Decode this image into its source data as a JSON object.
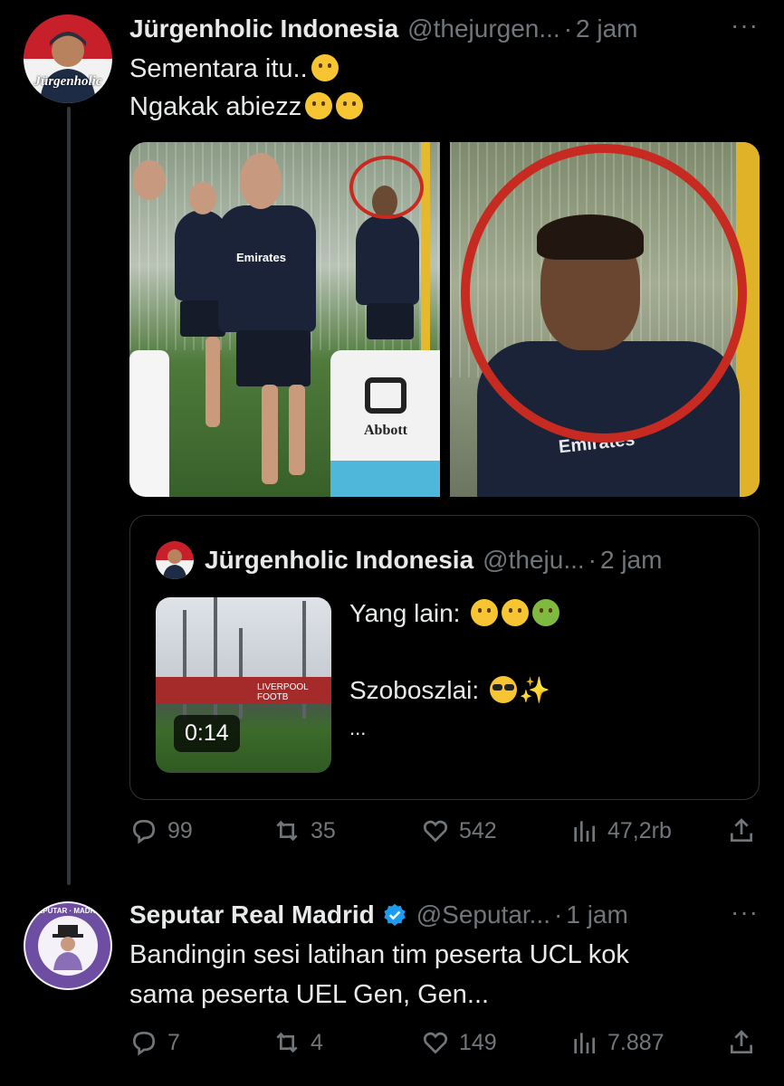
{
  "tweets": [
    {
      "author_name": "Jürgenholic Indonesia",
      "handle": "@thejurgen...",
      "separator": "·",
      "time": "2 jam",
      "more": "···",
      "avatar_text": "Jürgenholic",
      "lines": [
        "Sementara itu..",
        "Ngakak abiezz"
      ],
      "media": {
        "cooler_brand": "Abbott",
        "shirt_text": "Emirates"
      },
      "quote": {
        "author_name": "Jürgenholic Indonesia",
        "handle": "@theju...",
        "separator": "·",
        "time": "2 jam",
        "duration": "0:14",
        "stand_text": "LIVERPOOL FOOTB",
        "line1": "Yang lain:",
        "line2": "Szoboszlai:",
        "ellipsis": "..."
      },
      "stats": {
        "replies": "99",
        "reposts": "35",
        "likes": "542",
        "views": "47,2rb"
      }
    },
    {
      "author_name": "Seputar Real Madrid",
      "handle": "@Seputar...",
      "separator": "·",
      "time": "1 jam",
      "more": "···",
      "avatar_text": "SEPUTAR · MADRID",
      "lines": [
        "Bandingin sesi latihan tim peserta UCL kok",
        "sama peserta UEL Gen, Gen..."
      ],
      "stats": {
        "replies": "7",
        "reposts": "4",
        "likes": "149",
        "views": "7.887"
      }
    }
  ],
  "colors": {
    "background": "#000000",
    "text": "#e7e9ea",
    "muted": "#71767b",
    "verified": "#1d9bf0",
    "circle": "#c62a20"
  },
  "icons": [
    "reply-icon",
    "repost-icon",
    "like-icon",
    "views-icon",
    "share-icon",
    "verified-badge-icon",
    "more-icon"
  ]
}
